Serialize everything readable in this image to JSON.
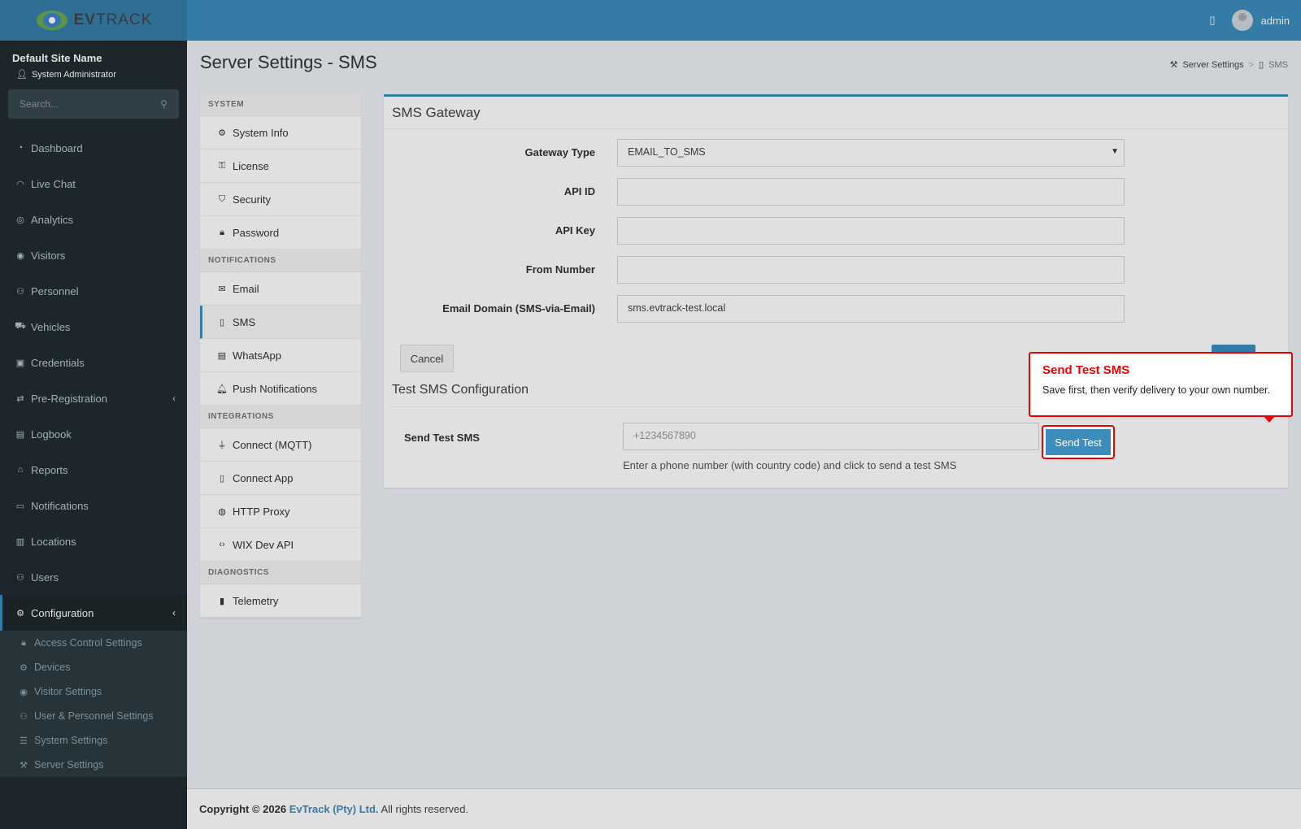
{
  "header": {
    "logo_text_1": "EV",
    "logo_text_2": "TRACK",
    "user": "admin"
  },
  "sidebar": {
    "site_name": "Default Site Name",
    "role": "System Administrator",
    "search_placeholder": "Search...",
    "items": [
      {
        "label": "Dashboard",
        "icon": "gauge-icon"
      },
      {
        "label": "Live Chat",
        "icon": "headset-icon"
      },
      {
        "label": "Analytics",
        "icon": "target-icon"
      },
      {
        "label": "Visitors",
        "icon": "eye-icon"
      },
      {
        "label": "Personnel",
        "icon": "user-group-icon"
      },
      {
        "label": "Vehicles",
        "icon": "car-icon"
      },
      {
        "label": "Credentials",
        "icon": "id-card-icon"
      },
      {
        "label": "Pre-Registration",
        "icon": "arrows-icon"
      },
      {
        "label": "Logbook",
        "icon": "book-icon"
      },
      {
        "label": "Reports",
        "icon": "chart-icon"
      },
      {
        "label": "Notifications",
        "icon": "bell-icon"
      },
      {
        "label": "Locations",
        "icon": "building-icon"
      },
      {
        "label": "Users",
        "icon": "users-icon"
      },
      {
        "label": "Configuration",
        "icon": "gear-icon"
      }
    ],
    "subitems": [
      {
        "label": "Access Control Settings"
      },
      {
        "label": "Devices"
      },
      {
        "label": "Visitor Settings"
      },
      {
        "label": "User & Personnel Settings"
      },
      {
        "label": "System Settings"
      },
      {
        "label": "Server Settings"
      }
    ]
  },
  "page": {
    "title": "Server Settings - SMS",
    "breadcrumb": [
      "Server Settings",
      "SMS"
    ]
  },
  "settings_nav": {
    "groups": [
      "SYSTEM",
      "NOTIFICATIONS",
      "INTEGRATIONS",
      "DIAGNOSTICS"
    ],
    "items": [
      "System Info",
      "License",
      "Security",
      "Password",
      "Email",
      "SMS",
      "WhatsApp",
      "Push Notifications",
      "Connect (MQTT)",
      "Connect App",
      "HTTP Proxy",
      "WIX Dev API",
      "Telemetry"
    ]
  },
  "gateway": {
    "title": "SMS Gateway",
    "fields": [
      {
        "label": "Gateway Type",
        "value": "EMAIL_TO_SMS"
      },
      {
        "label": "API ID",
        "value": ""
      },
      {
        "label": "API Key",
        "value": ""
      },
      {
        "label": "From Number",
        "value": ""
      },
      {
        "label": "Email Domain (SMS-via-Email)",
        "value": "sms.evtrack-test.local"
      }
    ],
    "cancel_label": "Cancel"
  },
  "test": {
    "section_title": "Test SMS Configuration",
    "label": "Send Test SMS",
    "placeholder": "+1234567890",
    "button": "Send Test",
    "help": "Enter a phone number (with country code) and click to send a test SMS"
  },
  "tooltip": {
    "title": "Send Test SMS",
    "body": "Save first, then verify delivery to your own number."
  },
  "footer": {
    "prefix": "Copyright © 2026",
    "company": "EvTrack (Pty) Ltd.",
    "suffix": "All rights reserved."
  },
  "colors": {
    "primary": "#3c8dbc",
    "sidebar": "#222d32",
    "highlight": "#e00000"
  }
}
